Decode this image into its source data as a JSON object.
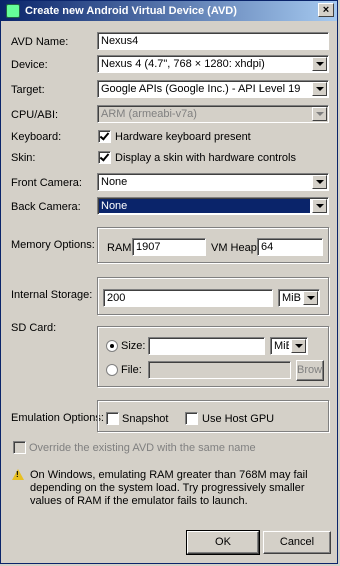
{
  "window": {
    "title": "Create new Android Virtual Device (AVD)",
    "close_glyph": "×"
  },
  "avd_name": {
    "label": "AVD Name:",
    "value": "Nexus4"
  },
  "device": {
    "label": "Device:",
    "value": "Nexus 4 (4.7\", 768 × 1280: xhdpi)"
  },
  "target": {
    "label": "Target:",
    "value": "Google APIs (Google Inc.) - API Level 19"
  },
  "cpu_abi": {
    "label": "CPU/ABI:",
    "value": "ARM (armeabi-v7a)"
  },
  "keyboard": {
    "label": "Keyboard:",
    "checkbox_label": "Hardware keyboard present",
    "checked": true
  },
  "skin": {
    "label": "Skin:",
    "checkbox_label": "Display a skin with hardware controls",
    "checked": true
  },
  "front_camera": {
    "label": "Front Camera:",
    "value": "None"
  },
  "back_camera": {
    "label": "Back Camera:",
    "value": "None"
  },
  "memory": {
    "label": "Memory Options:",
    "ram_label": "RAM:",
    "ram_value": "1907",
    "vm_heap_label": "VM Heap:",
    "vm_heap_value": "64"
  },
  "internal_storage": {
    "label": "Internal Storage:",
    "value": "200",
    "unit": "MiB"
  },
  "sd_card": {
    "label": "SD Card:",
    "size_label": "Size:",
    "size_value": "",
    "size_unit": "MiB",
    "file_label": "File:",
    "file_value": "",
    "browse_label": "Browse..."
  },
  "emulation": {
    "label": "Emulation Options:",
    "snapshot_label": "Snapshot",
    "host_gpu_label": "Use Host GPU"
  },
  "override": {
    "label": "Override the existing AVD with the same name"
  },
  "warning": {
    "text": "On Windows, emulating RAM greater than 768M may fail depending on the system load. Try progressively smaller values of RAM if the emulator fails to launch."
  },
  "buttons": {
    "ok": "OK",
    "cancel": "Cancel"
  }
}
